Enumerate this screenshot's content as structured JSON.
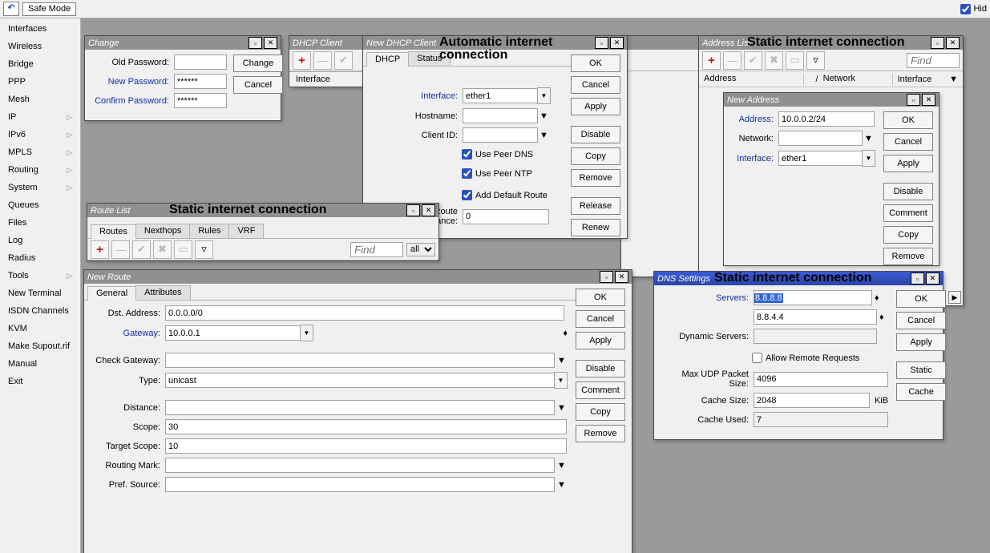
{
  "toolbar": {
    "refresh_glyph": "⭮",
    "safe_mode": "Safe Mode",
    "hid_label": "Hid"
  },
  "sidebar": {
    "items": [
      {
        "label": "Interfaces",
        "sub": false
      },
      {
        "label": "Wireless",
        "sub": false
      },
      {
        "label": "Bridge",
        "sub": false
      },
      {
        "label": "PPP",
        "sub": false
      },
      {
        "label": "Mesh",
        "sub": false
      },
      {
        "label": "IP",
        "sub": true
      },
      {
        "label": "IPv6",
        "sub": true
      },
      {
        "label": "MPLS",
        "sub": true
      },
      {
        "label": "Routing",
        "sub": true
      },
      {
        "label": "System",
        "sub": true
      },
      {
        "label": "Queues",
        "sub": false
      },
      {
        "label": "Files",
        "sub": false
      },
      {
        "label": "Log",
        "sub": false
      },
      {
        "label": "Radius",
        "sub": false
      },
      {
        "label": "Tools",
        "sub": true
      },
      {
        "label": "New Terminal",
        "sub": false
      },
      {
        "label": "ISDN Channels",
        "sub": false
      },
      {
        "label": "KVM",
        "sub": false
      },
      {
        "label": "Make Supout.rif",
        "sub": false
      },
      {
        "label": "Manual",
        "sub": false
      },
      {
        "label": "Exit",
        "sub": false
      }
    ]
  },
  "change_win": {
    "title": "Change",
    "old_lbl": "Old Password:",
    "new_lbl": "New Password:",
    "confirm_lbl": "Confirm Password:",
    "new_val": "******",
    "confirm_val": "******",
    "change_btn": "Change",
    "cancel_btn": "Cancel"
  },
  "dhcp_client": {
    "title": "DHCP Client",
    "header_interface": "Interface"
  },
  "new_dhcp": {
    "title": "New DHCP Client",
    "big_title1": "Automatic internet",
    "big_title2": "connection",
    "tabs": {
      "dhcp": "DHCP",
      "status": "Status"
    },
    "iface_lbl": "Interface:",
    "iface_val": "ether1",
    "host_lbl": "Hostname:",
    "client_lbl": "Client ID:",
    "peer_dns": "Use Peer DNS",
    "peer_ntp": "Use Peer NTP",
    "add_route": "Add Default Route",
    "dist_lbl": "Default Route Distance:",
    "dist_val": "0",
    "btns": {
      "ok": "OK",
      "cancel": "Cancel",
      "apply": "Apply",
      "disable": "Disable",
      "copy": "Copy",
      "remove": "Remove",
      "release": "Release",
      "renew": "Renew"
    }
  },
  "route_list": {
    "title": "Route List",
    "big_title": "Static internet connection",
    "tabs": {
      "routes": "Routes",
      "nexthops": "Nexthops",
      "rules": "Rules",
      "vrf": "VRF"
    },
    "find_ph": "Find",
    "all_opt": "all"
  },
  "new_route": {
    "title": "New Route",
    "tabs": {
      "general": "General",
      "attributes": "Attributes"
    },
    "dst_lbl": "Dst. Address:",
    "dst_val": "0.0.0.0/0",
    "gw_lbl": "Gateway:",
    "gw_val": "10.0.0.1",
    "check_lbl": "Check Gateway:",
    "type_lbl": "Type:",
    "type_val": "unicast",
    "dist_lbl": "Distance:",
    "scope_lbl": "Scope:",
    "scope_val": "30",
    "tscope_lbl": "Target Scope:",
    "tscope_val": "10",
    "rmark_lbl": "Routing Mark:",
    "psrc_lbl": "Pref. Source:",
    "btns": {
      "ok": "OK",
      "cancel": "Cancel",
      "apply": "Apply",
      "disable": "Disable",
      "comment": "Comment",
      "copy": "Copy",
      "remove": "Remove"
    }
  },
  "addr_list": {
    "title": "Address List",
    "big_title": "Static internet connection",
    "find_ph": "Find",
    "cols": {
      "address": "Address",
      "network": "Network",
      "interface": "Interface"
    }
  },
  "new_addr": {
    "title": "New Address",
    "addr_lbl": "Address:",
    "addr_val": "10.0.0.2/24",
    "net_lbl": "Network:",
    "iface_lbl": "Interface:",
    "iface_val": "ether1",
    "btns": {
      "ok": "OK",
      "cancel": "Cancel",
      "apply": "Apply",
      "disable": "Disable",
      "comment": "Comment",
      "copy": "Copy",
      "remove": "Remove"
    }
  },
  "dns": {
    "title": "DNS Settings",
    "big_title": "Static internet connection",
    "servers_lbl": "Servers:",
    "server1": "8.8.8.8",
    "server2": "8.8.4.4",
    "dyn_lbl": "Dynamic Servers:",
    "allow_remote": "Allow Remote Requests",
    "udp_lbl": "Max UDP Packet Size:",
    "udp_val": "4096",
    "cache_lbl": "Cache Size:",
    "cache_val": "2048",
    "kib": "KiB",
    "used_lbl": "Cache Used:",
    "used_val": "7",
    "btns": {
      "ok": "OK",
      "cancel": "Cancel",
      "apply": "Apply",
      "static": "Static",
      "cache": "Cache"
    }
  },
  "partial_find": "Find"
}
